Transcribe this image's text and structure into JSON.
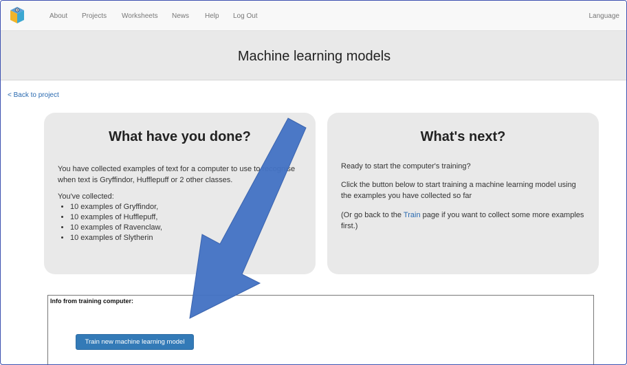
{
  "nav": {
    "items": [
      "About",
      "Projects",
      "Worksheets",
      "News",
      "Help",
      "Log Out"
    ],
    "language": "Language"
  },
  "page": {
    "title": "Machine learning models",
    "back_link": "< Back to project"
  },
  "left_panel": {
    "heading": "What have you done?",
    "description": "You have collected examples of text for a computer to use to recognise when text is Gryffindor, Hufflepuff or 2 other classes.",
    "collected_label": "You've collected:",
    "items": [
      "10 examples of Gryffindor,",
      "10 examples of Hufflepuff,",
      "10 examples of Ravenclaw,",
      "10 examples of Slytherin"
    ]
  },
  "right_panel": {
    "heading": "What's next?",
    "line1": "Ready to start the computer's training?",
    "line2": "Click the button below to start training a machine learning model using the examples you have collected so far",
    "line3_prefix": "(Or go back to the ",
    "line3_link": "Train",
    "line3_suffix": " page if you want to collect some more examples first.)"
  },
  "info_box": {
    "title": "Info from training computer:",
    "button_label": "Train new machine learning model"
  },
  "colors": {
    "arrow": "#4472c4",
    "button": "#337ab7",
    "link": "#2a6ab0"
  }
}
